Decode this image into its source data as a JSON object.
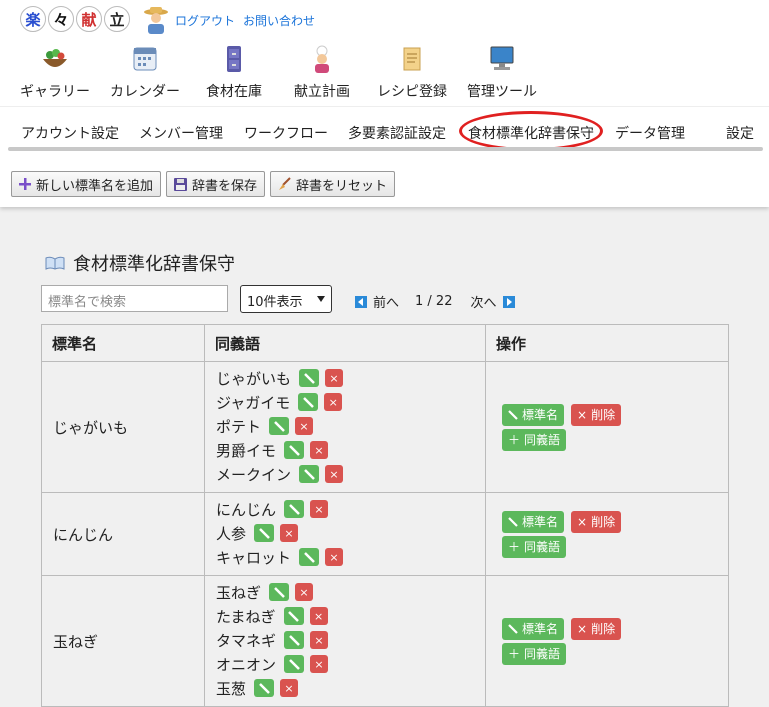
{
  "app": {
    "logo_chars": [
      "楽",
      "々",
      "献",
      "立"
    ],
    "links": [
      "ログアウト",
      "お問い合わせ"
    ]
  },
  "nav": [
    {
      "label": "ギャラリー",
      "icon": "salad-bowl-icon"
    },
    {
      "label": "カレンダー",
      "icon": "calendar-icon"
    },
    {
      "label": "食材在庫",
      "icon": "cabinet-icon"
    },
    {
      "label": "献立計画",
      "icon": "chef-icon"
    },
    {
      "label": "レシピ登録",
      "icon": "scroll-icon"
    },
    {
      "label": "管理ツール",
      "icon": "computer-icon"
    }
  ],
  "subnav": [
    "アカウント設定",
    "メンバー管理",
    "ワークフロー",
    "多要素認証設定",
    "食材標準化辞書保守",
    "データ管理",
    "設定"
  ],
  "toolbar": {
    "add": "新しい標準名を追加",
    "save": "辞書を保存",
    "reset": "辞書をリセット"
  },
  "page": {
    "title": "食材標準化辞書保守",
    "search_placeholder": "標準名で検索",
    "page_size": "10件表示",
    "prev": "前へ",
    "page_info": "1 / 22",
    "next": "次へ"
  },
  "table": {
    "headers": [
      "標準名",
      "同義語",
      "操作"
    ],
    "rows": [
      {
        "name": "じゃがいも",
        "synonyms": [
          "じゃがいも",
          "ジャガイモ",
          "ポテト",
          "男爵イモ",
          "メークイン"
        ]
      },
      {
        "name": "にんじん",
        "synonyms": [
          "にんじん",
          "人参",
          "キャロット"
        ]
      },
      {
        "name": "玉ねぎ",
        "synonyms": [
          "玉ねぎ",
          "たまねぎ",
          "タマネギ",
          "オニオン",
          "玉葱"
        ]
      }
    ],
    "op_edit": "標準名",
    "op_delete": "削除",
    "op_add_synonym": "同義語"
  },
  "colors": {
    "accent_link": "#1a73d9",
    "green": "#5cb85c",
    "red": "#d9534f",
    "highlight_circle": "#e02020"
  }
}
